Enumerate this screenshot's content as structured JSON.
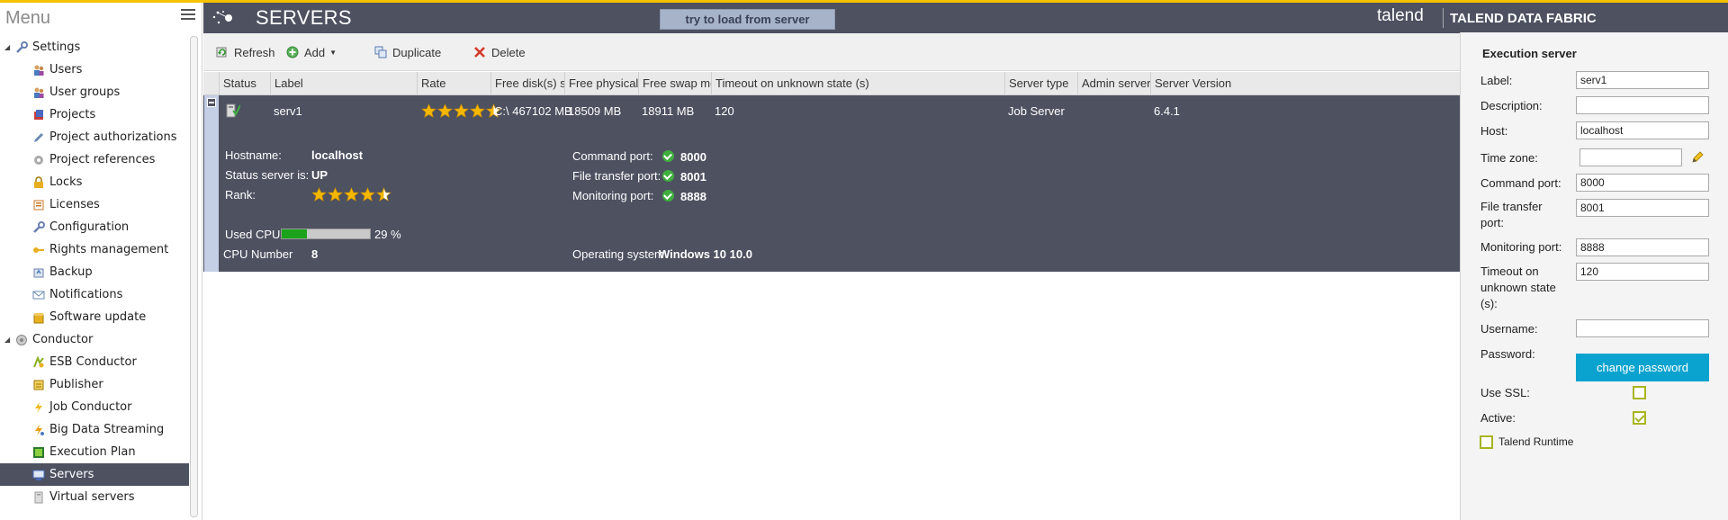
{
  "sidebar": {
    "menu_title": "Menu",
    "groups": [
      {
        "label": "Settings",
        "items": [
          "Users",
          "User groups",
          "Projects",
          "Project authorizations",
          "Project references",
          "Locks",
          "Licenses",
          "Configuration",
          "Rights management",
          "Backup",
          "Notifications",
          "Software update"
        ]
      },
      {
        "label": "Conductor",
        "items": [
          "ESB Conductor",
          "Publisher",
          "Job Conductor",
          "Big Data Streaming",
          "Execution Plan",
          "Servers",
          "Virtual servers"
        ]
      }
    ],
    "selected": "Servers"
  },
  "header": {
    "title": "SERVERS",
    "load_button": "try to load from server",
    "brand_logo": "talend",
    "brand_product": "TALEND DATA FABRIC"
  },
  "toolbar": {
    "refresh": "Refresh",
    "add": "Add",
    "duplicate": "Duplicate",
    "delete": "Delete"
  },
  "grid": {
    "columns": [
      "Status",
      "Label",
      "Rate",
      "Free disk(s) s...",
      "Free physical ...",
      "Free swap me...",
      "Timeout on unknown state (s)",
      "Server type",
      "Admin server",
      "Server Version"
    ],
    "row": {
      "label": "serv1",
      "rate": 4.5,
      "free_disk": "C:\\ 467102 MB",
      "free_physical": "18509 MB",
      "free_swap": "18911 MB",
      "timeout": "120",
      "server_type": "Job Server",
      "admin_server": "",
      "server_version": "6.4.1"
    },
    "details": {
      "hostname_label": "Hostname:",
      "hostname": "localhost",
      "status_label": "Status server is:",
      "status": "UP",
      "rank_label": "Rank:",
      "rank": 4.5,
      "command_port_label": "Command port:",
      "command_port": "8000",
      "file_transfer_port_label": "File transfer port:",
      "file_transfer_port": "8001",
      "monitoring_port_label": "Monitoring port:",
      "monitoring_port": "8888",
      "used_cpu_label": "Used CPU",
      "used_cpu_percent": 29,
      "used_cpu_text": "29 %",
      "cpu_number_label": "CPU Number",
      "cpu_number": "8",
      "os_label": "Operating system",
      "os": "Windows 10 10.0"
    }
  },
  "panel": {
    "title": "Execution server",
    "label_label": "Label:",
    "label_value": "serv1",
    "description_label": "Description:",
    "description_value": "",
    "host_label": "Host:",
    "host_value": "localhost",
    "timezone_label": "Time zone:",
    "timezone_value": "",
    "command_port_label": "Command port:",
    "command_port_value": "8000",
    "file_transfer_label_1": "File transfer",
    "file_transfer_label_2": "port:",
    "file_transfer_value": "8001",
    "monitoring_port_label": "Monitoring port:",
    "monitoring_port_value": "8888",
    "timeout_label_1": "Timeout on",
    "timeout_label_2": "unknown state",
    "timeout_label_3": "(s):",
    "timeout_value": "120",
    "username_label": "Username:",
    "username_value": "",
    "password_label": "Password:",
    "change_password": "change password",
    "use_ssl_label": "Use SSL:",
    "use_ssl": false,
    "active_label": "Active:",
    "active": true,
    "talend_runtime_label": "Talend Runtime",
    "talend_runtime": false
  },
  "colors": {
    "accent_top": "#f5c200",
    "header_bg": "#4d5160",
    "button_blue": "#0aa3cf",
    "checkbox_green": "#a8b521"
  }
}
